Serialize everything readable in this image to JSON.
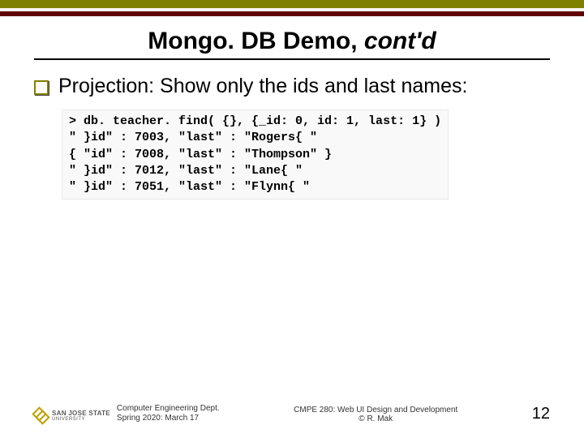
{
  "title": {
    "main": "Mongo. DB Demo, ",
    "em": "cont'd"
  },
  "bullet": "Projection: Show only the ids and last names:",
  "code": {
    "l1": "> db. teacher. find( {}, {_id: 0, id: 1, last: 1} )",
    "l2": "\" }id\" : 7003, \"last\" : \"Rogers{ \"",
    "l3": "{ \"id\" : 7008, \"last\" : \"Thompson\" }",
    "l4": "\" }id\" : 7012, \"last\" : \"Lane{ \"",
    "l5": "\" }id\" : 7051, \"last\" : \"Flynn{ \""
  },
  "footer": {
    "dept_line1": "Computer Engineering Dept.",
    "dept_line2": "Spring 2020: March 17",
    "center_line1": "CMPE 280: Web UI Design and Development",
    "center_line2": "© R. Mak",
    "page": "12",
    "logo": {
      "line1": "SAN JOSE STATE",
      "line2": "UNIVERSITY"
    }
  },
  "chart_data": {
    "type": "table",
    "title": "MongoDB projection output (ids and last names)",
    "columns": [
      "id",
      "last"
    ],
    "rows": [
      {
        "id": 7003,
        "last": "Rogers"
      },
      {
        "id": 7008,
        "last": "Thompson"
      },
      {
        "id": 7012,
        "last": "Lane"
      },
      {
        "id": 7051,
        "last": "Flynn"
      }
    ],
    "query": "db.teacher.find( {}, {_id: 0, id: 1, last: 1} )"
  }
}
